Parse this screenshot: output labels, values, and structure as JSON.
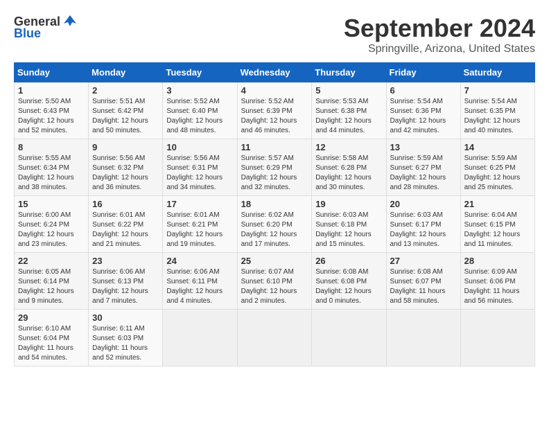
{
  "header": {
    "logo_general": "General",
    "logo_blue": "Blue",
    "month_title": "September 2024",
    "location": "Springville, Arizona, United States"
  },
  "weekdays": [
    "Sunday",
    "Monday",
    "Tuesday",
    "Wednesday",
    "Thursday",
    "Friday",
    "Saturday"
  ],
  "weeks": [
    [
      {
        "day": "1",
        "sunrise": "5:50 AM",
        "sunset": "6:43 PM",
        "daylight": "12 hours and 52 minutes."
      },
      {
        "day": "2",
        "sunrise": "5:51 AM",
        "sunset": "6:42 PM",
        "daylight": "12 hours and 50 minutes."
      },
      {
        "day": "3",
        "sunrise": "5:52 AM",
        "sunset": "6:40 PM",
        "daylight": "12 hours and 48 minutes."
      },
      {
        "day": "4",
        "sunrise": "5:52 AM",
        "sunset": "6:39 PM",
        "daylight": "12 hours and 46 minutes."
      },
      {
        "day": "5",
        "sunrise": "5:53 AM",
        "sunset": "6:38 PM",
        "daylight": "12 hours and 44 minutes."
      },
      {
        "day": "6",
        "sunrise": "5:54 AM",
        "sunset": "6:36 PM",
        "daylight": "12 hours and 42 minutes."
      },
      {
        "day": "7",
        "sunrise": "5:54 AM",
        "sunset": "6:35 PM",
        "daylight": "12 hours and 40 minutes."
      }
    ],
    [
      {
        "day": "8",
        "sunrise": "5:55 AM",
        "sunset": "6:34 PM",
        "daylight": "12 hours and 38 minutes."
      },
      {
        "day": "9",
        "sunrise": "5:56 AM",
        "sunset": "6:32 PM",
        "daylight": "12 hours and 36 minutes."
      },
      {
        "day": "10",
        "sunrise": "5:56 AM",
        "sunset": "6:31 PM",
        "daylight": "12 hours and 34 minutes."
      },
      {
        "day": "11",
        "sunrise": "5:57 AM",
        "sunset": "6:29 PM",
        "daylight": "12 hours and 32 minutes."
      },
      {
        "day": "12",
        "sunrise": "5:58 AM",
        "sunset": "6:28 PM",
        "daylight": "12 hours and 30 minutes."
      },
      {
        "day": "13",
        "sunrise": "5:59 AM",
        "sunset": "6:27 PM",
        "daylight": "12 hours and 28 minutes."
      },
      {
        "day": "14",
        "sunrise": "5:59 AM",
        "sunset": "6:25 PM",
        "daylight": "12 hours and 25 minutes."
      }
    ],
    [
      {
        "day": "15",
        "sunrise": "6:00 AM",
        "sunset": "6:24 PM",
        "daylight": "12 hours and 23 minutes."
      },
      {
        "day": "16",
        "sunrise": "6:01 AM",
        "sunset": "6:22 PM",
        "daylight": "12 hours and 21 minutes."
      },
      {
        "day": "17",
        "sunrise": "6:01 AM",
        "sunset": "6:21 PM",
        "daylight": "12 hours and 19 minutes."
      },
      {
        "day": "18",
        "sunrise": "6:02 AM",
        "sunset": "6:20 PM",
        "daylight": "12 hours and 17 minutes."
      },
      {
        "day": "19",
        "sunrise": "6:03 AM",
        "sunset": "6:18 PM",
        "daylight": "12 hours and 15 minutes."
      },
      {
        "day": "20",
        "sunrise": "6:03 AM",
        "sunset": "6:17 PM",
        "daylight": "12 hours and 13 minutes."
      },
      {
        "day": "21",
        "sunrise": "6:04 AM",
        "sunset": "6:15 PM",
        "daylight": "12 hours and 11 minutes."
      }
    ],
    [
      {
        "day": "22",
        "sunrise": "6:05 AM",
        "sunset": "6:14 PM",
        "daylight": "12 hours and 9 minutes."
      },
      {
        "day": "23",
        "sunrise": "6:06 AM",
        "sunset": "6:13 PM",
        "daylight": "12 hours and 7 minutes."
      },
      {
        "day": "24",
        "sunrise": "6:06 AM",
        "sunset": "6:11 PM",
        "daylight": "12 hours and 4 minutes."
      },
      {
        "day": "25",
        "sunrise": "6:07 AM",
        "sunset": "6:10 PM",
        "daylight": "12 hours and 2 minutes."
      },
      {
        "day": "26",
        "sunrise": "6:08 AM",
        "sunset": "6:08 PM",
        "daylight": "12 hours and 0 minutes."
      },
      {
        "day": "27",
        "sunrise": "6:08 AM",
        "sunset": "6:07 PM",
        "daylight": "11 hours and 58 minutes."
      },
      {
        "day": "28",
        "sunrise": "6:09 AM",
        "sunset": "6:06 PM",
        "daylight": "11 hours and 56 minutes."
      }
    ],
    [
      {
        "day": "29",
        "sunrise": "6:10 AM",
        "sunset": "6:04 PM",
        "daylight": "11 hours and 54 minutes."
      },
      {
        "day": "30",
        "sunrise": "6:11 AM",
        "sunset": "6:03 PM",
        "daylight": "11 hours and 52 minutes."
      },
      null,
      null,
      null,
      null,
      null
    ]
  ]
}
